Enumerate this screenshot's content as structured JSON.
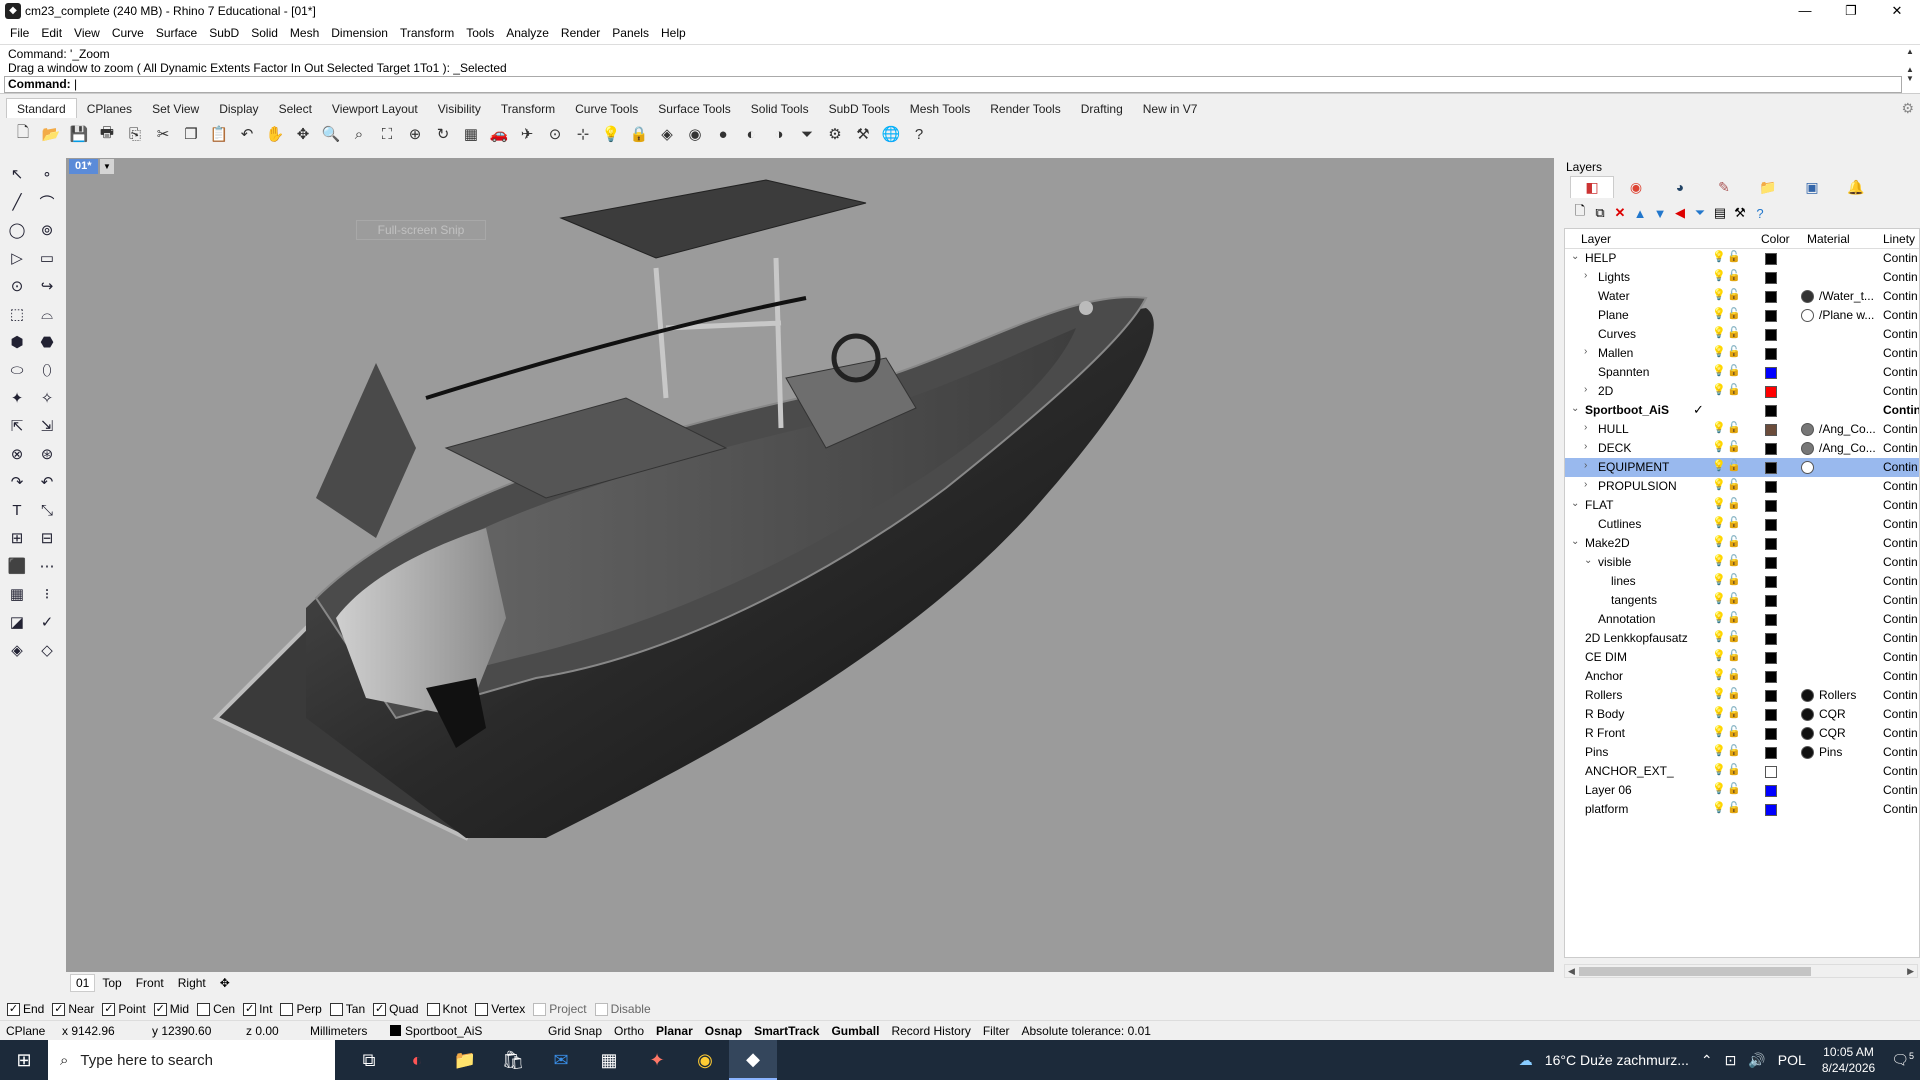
{
  "window": {
    "title": "cm23_complete (240 MB) - Rhino 7 Educational - [01*]",
    "controls": [
      "—",
      "❐",
      "✕"
    ]
  },
  "menu": [
    "File",
    "Edit",
    "View",
    "Curve",
    "Surface",
    "SubD",
    "Solid",
    "Mesh",
    "Dimension",
    "Transform",
    "Tools",
    "Analyze",
    "Render",
    "Panels",
    "Help"
  ],
  "command": {
    "history_1": "Command: '_Zoom",
    "history_2": "Drag a window to zoom ( All  Dynamic  Extents  Factor  In  Out  Selected  Target  1To1 ): _Selected",
    "prompt": "Command:"
  },
  "toolbar_tabs": [
    "Standard",
    "CPlanes",
    "Set View",
    "Display",
    "Select",
    "Viewport Layout",
    "Visibility",
    "Transform",
    "Curve Tools",
    "Surface Tools",
    "Solid Tools",
    "SubD Tools",
    "Mesh Tools",
    "Render Tools",
    "Drafting",
    "New in V7"
  ],
  "toolbar_icons": [
    {
      "name": "new-file-icon",
      "glyph": "🗋"
    },
    {
      "name": "open-file-icon",
      "glyph": "📂"
    },
    {
      "name": "save-icon",
      "glyph": "💾"
    },
    {
      "name": "print-icon",
      "glyph": "🖶"
    },
    {
      "name": "export-icon",
      "glyph": "⎘"
    },
    {
      "name": "cut-icon",
      "glyph": "✂"
    },
    {
      "name": "copy-icon",
      "glyph": "❐"
    },
    {
      "name": "paste-icon",
      "glyph": "📋"
    },
    {
      "name": "undo-icon",
      "glyph": "↶"
    },
    {
      "name": "pan-icon",
      "glyph": "✋"
    },
    {
      "name": "move-view-icon",
      "glyph": "✥"
    },
    {
      "name": "zoom-icon",
      "glyph": "🔍"
    },
    {
      "name": "zoom-window-icon",
      "glyph": "⌕"
    },
    {
      "name": "zoom-extents-icon",
      "glyph": "⛶"
    },
    {
      "name": "zoom-selected-icon",
      "glyph": "⊕"
    },
    {
      "name": "rotate-view-icon",
      "glyph": "↻"
    },
    {
      "name": "viewport-layout-icon",
      "glyph": "▦"
    },
    {
      "name": "car-icon",
      "glyph": "🚗"
    },
    {
      "name": "plane-icon",
      "glyph": "✈"
    },
    {
      "name": "cplane-icon",
      "glyph": "⊙"
    },
    {
      "name": "snap-icon",
      "glyph": "⊹"
    },
    {
      "name": "light-icon",
      "glyph": "💡"
    },
    {
      "name": "lock-icon",
      "glyph": "🔒"
    },
    {
      "name": "material-icon",
      "glyph": "◈"
    },
    {
      "name": "color-wheel-icon",
      "glyph": "◉"
    },
    {
      "name": "shaded-sphere-icon",
      "glyph": "●"
    },
    {
      "name": "render-sphere-icon",
      "glyph": "◐"
    },
    {
      "name": "rendered-sphere-icon",
      "glyph": "◑"
    },
    {
      "name": "filter-icon",
      "glyph": "⏷"
    },
    {
      "name": "options-gear-icon",
      "glyph": "⚙"
    },
    {
      "name": "grasshopper-icon",
      "glyph": "⚒"
    },
    {
      "name": "globe-icon",
      "glyph": "🌐"
    },
    {
      "name": "help-icon",
      "glyph": "?"
    }
  ],
  "left_tools": [
    "↖",
    "∘",
    "╱",
    "⌒",
    "◯",
    "⊚",
    "▷",
    "▭",
    "⊙",
    "↪",
    "⬚",
    "⌓",
    "⬢",
    "⬣",
    "⬭",
    "⬯",
    "✦",
    "✧",
    "⇱",
    "⇲",
    "⊗",
    "⊛",
    "↷",
    "↶",
    "T",
    "⤡",
    "⊞",
    "⊟",
    "⬛",
    "⋯",
    "▦",
    "⁝",
    "◪",
    "✓",
    "◈",
    "◇"
  ],
  "viewport": {
    "label": "01*",
    "snip_text": "Full-screen Snip",
    "tabs": [
      "01",
      "Top",
      "Front",
      "Right",
      "✥"
    ]
  },
  "osnap": [
    {
      "label": "End",
      "checked": true
    },
    {
      "label": "Near",
      "checked": true
    },
    {
      "label": "Point",
      "checked": true
    },
    {
      "label": "Mid",
      "checked": true
    },
    {
      "label": "Cen",
      "checked": false
    },
    {
      "label": "Int",
      "checked": true
    },
    {
      "label": "Perp",
      "checked": false
    },
    {
      "label": "Tan",
      "checked": false
    },
    {
      "label": "Quad",
      "checked": true
    },
    {
      "label": "Knot",
      "checked": false
    },
    {
      "label": "Vertex",
      "checked": false
    },
    {
      "label": "Project",
      "checked": false,
      "disabled": true
    },
    {
      "label": "Disable",
      "checked": false,
      "disabled": true
    }
  ],
  "status": {
    "cplane": "CPlane",
    "x": "x 9142.96",
    "y": "y 12390.60",
    "z": "z 0.00",
    "units": "Millimeters",
    "layer": "Sportboot_AiS",
    "grid_snap": "Grid Snap",
    "ortho": "Ortho",
    "planar": "Planar",
    "osnap": "Osnap",
    "smarttrack": "SmartTrack",
    "gumball": "Gumball",
    "record_history": "Record History",
    "filter": "Filter",
    "tolerance": "Absolute tolerance: 0.01"
  },
  "taskbar": {
    "search_placeholder": "Type here to search",
    "weather": "16°C  Duże zachmurz...",
    "language": "POL",
    "time": "10:05 AM",
    "date": "8/24/2026",
    "notification_count": "5"
  },
  "layers": {
    "title": "Layers",
    "columns": [
      "Layer",
      "Color",
      "Material",
      "Linety"
    ],
    "tab_icons": [
      "layers-tab-icon",
      "color-tab-icon",
      "display-tab-icon",
      "paint-tab-icon",
      "folder-tab-icon",
      "image-tab-icon",
      "notify-tab-icon"
    ],
    "colors": {
      "selection": "#99b9ee",
      "viewport": "#9b9b9b",
      "viewport_label": "#5b8bd8"
    },
    "rows": [
      {
        "name": "HELP",
        "indent": 0,
        "expander": "⌄",
        "bold": false,
        "color": "#000000",
        "material": "",
        "mat_color": "",
        "linetype": "Contin",
        "bulb": "blue"
      },
      {
        "name": "Lights",
        "indent": 1,
        "expander": "›",
        "bold": false,
        "color": "#000000",
        "material": "",
        "mat_color": "",
        "linetype": "Contin",
        "bulb": "yellow"
      },
      {
        "name": "Water",
        "indent": 1,
        "expander": "",
        "bold": false,
        "color": "#000000",
        "material": "/Water_t...",
        "mat_color": "#333333",
        "linetype": "Contin",
        "bulb": "yellow"
      },
      {
        "name": "Plane",
        "indent": 1,
        "expander": "",
        "bold": false,
        "color": "#000000",
        "material": "/Plane w...",
        "mat_color": "#ffffff",
        "linetype": "Contin",
        "bulb": "yellow"
      },
      {
        "name": "Curves",
        "indent": 1,
        "expander": "",
        "bold": false,
        "color": "#000000",
        "material": "",
        "mat_color": "",
        "linetype": "Contin",
        "bulb": "yellow"
      },
      {
        "name": "Mallen",
        "indent": 1,
        "expander": "›",
        "bold": false,
        "color": "#000000",
        "material": "",
        "mat_color": "",
        "linetype": "Contin",
        "bulb": "yellow"
      },
      {
        "name": "Spannten",
        "indent": 1,
        "expander": "",
        "bold": false,
        "color": "#0000ff",
        "material": "",
        "mat_color": "",
        "linetype": "Contin",
        "bulb": "yellow"
      },
      {
        "name": "2D",
        "indent": 1,
        "expander": "›",
        "bold": false,
        "color": "#ff0000",
        "material": "",
        "mat_color": "",
        "linetype": "Contin",
        "bulb": "yellow"
      },
      {
        "name": "Sportboot_AiS",
        "indent": 0,
        "expander": "⌄",
        "bold": true,
        "current": true,
        "color": "#000000",
        "material": "",
        "mat_color": "",
        "linetype": "Contin",
        "bulb": ""
      },
      {
        "name": "HULL",
        "indent": 1,
        "expander": "›",
        "bold": false,
        "color": "#6b4c3b",
        "material": "/Ang_Co...",
        "mat_color": "#777777",
        "linetype": "Contin",
        "bulb": "yellow"
      },
      {
        "name": "DECK",
        "indent": 1,
        "expander": "›",
        "bold": false,
        "color": "#000000",
        "material": "/Ang_Co...",
        "mat_color": "#777777",
        "linetype": "Contin",
        "bulb": "yellow"
      },
      {
        "name": "EQUIPMENT",
        "indent": 1,
        "expander": "›",
        "bold": false,
        "selected": true,
        "color": "#000000",
        "material": "",
        "mat_color": "#ffffff",
        "linetype": "Contin",
        "bulb": "yellow"
      },
      {
        "name": "PROPULSION",
        "indent": 1,
        "expander": "›",
        "bold": false,
        "color": "#000000",
        "material": "",
        "mat_color": "",
        "linetype": "Contin",
        "bulb": "yellow"
      },
      {
        "name": "FLAT",
        "indent": 0,
        "expander": "⌄",
        "bold": false,
        "color": "#000000",
        "material": "",
        "mat_color": "",
        "linetype": "Contin",
        "bulb": "yellow"
      },
      {
        "name": "Cutlines",
        "indent": 1,
        "expander": "",
        "bold": false,
        "color": "#000000",
        "material": "",
        "mat_color": "",
        "linetype": "Contin",
        "bulb": "yellow"
      },
      {
        "name": "Make2D",
        "indent": 0,
        "expander": "⌄",
        "bold": false,
        "color": "#000000",
        "material": "",
        "mat_color": "",
        "linetype": "Contin",
        "bulb": "blue"
      },
      {
        "name": "visible",
        "indent": 1,
        "expander": "⌄",
        "bold": false,
        "color": "#000000",
        "material": "",
        "mat_color": "",
        "linetype": "Contin",
        "bulb": "yellow"
      },
      {
        "name": "lines",
        "indent": 2,
        "expander": "",
        "bold": false,
        "color": "#000000",
        "material": "",
        "mat_color": "",
        "linetype": "Contin",
        "bulb": "yellow"
      },
      {
        "name": "tangents",
        "indent": 2,
        "expander": "",
        "bold": false,
        "color": "#000000",
        "material": "",
        "mat_color": "",
        "linetype": "Contin",
        "bulb": "yellow"
      },
      {
        "name": "Annotation",
        "indent": 1,
        "expander": "",
        "bold": false,
        "color": "#000000",
        "material": "",
        "mat_color": "",
        "linetype": "Contin",
        "bulb": "yellow"
      },
      {
        "name": "2D Lenkkopfausatz",
        "indent": 0,
        "expander": "",
        "bold": false,
        "color": "#000000",
        "material": "",
        "mat_color": "",
        "linetype": "Contin",
        "bulb": "blue"
      },
      {
        "name": "CE DIM",
        "indent": 0,
        "expander": "",
        "bold": false,
        "color": "#000000",
        "material": "",
        "mat_color": "",
        "linetype": "Contin",
        "bulb": "blue"
      },
      {
        "name": "Anchor",
        "indent": 0,
        "expander": "",
        "bold": false,
        "color": "#000000",
        "material": "",
        "mat_color": "",
        "linetype": "Contin",
        "bulb": "yellow"
      },
      {
        "name": "Rollers",
        "indent": 0,
        "expander": "",
        "bold": false,
        "color": "#000000",
        "material": "Rollers",
        "mat_color": "#111111",
        "linetype": "Contin",
        "bulb": "yellow"
      },
      {
        "name": "R Body",
        "indent": 0,
        "expander": "",
        "bold": false,
        "color": "#000000",
        "material": "CQR",
        "mat_color": "#111111",
        "linetype": "Contin",
        "bulb": "yellow"
      },
      {
        "name": "R Front",
        "indent": 0,
        "expander": "",
        "bold": false,
        "color": "#000000",
        "material": "CQR",
        "mat_color": "#111111",
        "linetype": "Contin",
        "bulb": "yellow"
      },
      {
        "name": "Pins",
        "indent": 0,
        "expander": "",
        "bold": false,
        "color": "#000000",
        "material": "Pins",
        "mat_color": "#111111",
        "linetype": "Contin",
        "bulb": "yellow"
      },
      {
        "name": "ANCHOR_EXT_",
        "indent": 0,
        "expander": "",
        "bold": false,
        "color": "#ffffff",
        "material": "",
        "mat_color": "",
        "linetype": "Contin",
        "bulb": "yellow"
      },
      {
        "name": "Layer 06",
        "indent": 0,
        "expander": "",
        "bold": false,
        "color": "#0000ff",
        "material": "",
        "mat_color": "",
        "linetype": "Contin",
        "bulb": "yellow"
      },
      {
        "name": "platform",
        "indent": 0,
        "expander": "",
        "bold": false,
        "color": "#0000ff",
        "material": "",
        "mat_color": "",
        "linetype": "Contin",
        "bulb": "yellow"
      }
    ]
  }
}
